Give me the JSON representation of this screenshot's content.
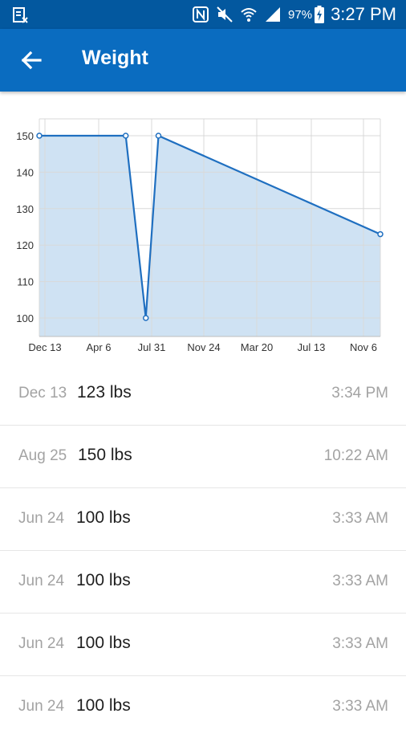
{
  "status_bar": {
    "battery_percent": "97%",
    "time": "3:27 PM"
  },
  "app_bar": {
    "title": "Weight"
  },
  "chart_data": {
    "type": "area",
    "x_tick_labels": [
      "Dec 13",
      "Apr 6",
      "Jul 31",
      "Nov 24",
      "Mar 20",
      "Jul 13",
      "Nov 6"
    ],
    "y_ticks": [
      100,
      110,
      120,
      130,
      140,
      150
    ],
    "points": [
      {
        "date": "2013-12-13",
        "value": 150
      },
      {
        "date": "2014-06-16",
        "value": 150
      },
      {
        "date": "2014-07-29",
        "value": 100
      },
      {
        "date": "2014-08-25",
        "value": 150
      },
      {
        "date": "2015-12-13",
        "value": 123
      }
    ],
    "grid": true,
    "colors": {
      "line": "#1f6fc0",
      "fill": "#cfe2f3",
      "grid": "#d9d9d9"
    }
  },
  "entries": [
    {
      "date": "Dec 13",
      "weight": "123 lbs",
      "time": "3:34 PM"
    },
    {
      "date": "Aug 25",
      "weight": "150 lbs",
      "time": "10:22 AM"
    },
    {
      "date": "Jun 24",
      "weight": "100 lbs",
      "time": "3:33 AM"
    },
    {
      "date": "Jun 24",
      "weight": "100 lbs",
      "time": "3:33 AM"
    },
    {
      "date": "Jun 24",
      "weight": "100 lbs",
      "time": "3:33 AM"
    },
    {
      "date": "Jun 24",
      "weight": "100 lbs",
      "time": "3:33 AM"
    }
  ]
}
